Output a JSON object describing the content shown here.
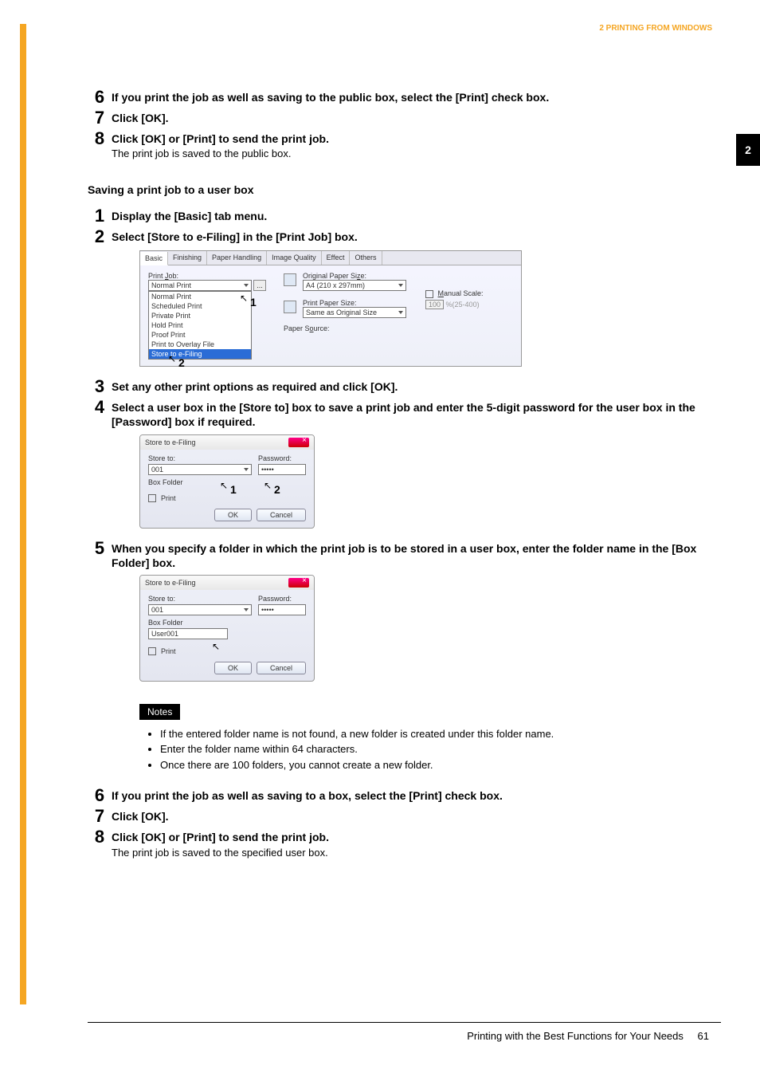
{
  "header": {
    "breadcrumb": "2 PRINTING FROM WINDOWS"
  },
  "chapter_tab": "2",
  "top_steps": [
    {
      "num": "6",
      "main": "If you print the job as well as saving to the public box, select the [Print] check box."
    },
    {
      "num": "7",
      "main": "Click [OK]."
    },
    {
      "num": "8",
      "main": "Click [OK] or [Print] to send the print job.",
      "sub": "The print job is saved to the public box."
    }
  ],
  "section_heading": "Saving a print job to a user box",
  "steps_a": [
    {
      "num": "1",
      "main": "Display the [Basic] tab menu."
    },
    {
      "num": "2",
      "main": "Select [Store to e-Filing] in the [Print Job] box."
    }
  ],
  "screenshot1": {
    "tabs": [
      "Basic",
      "Finishing",
      "Paper Handling",
      "Image Quality",
      "Effect",
      "Others"
    ],
    "printjob_label": "Print Job:",
    "printjob_value": "Normal Print",
    "job_options": [
      "Normal Print",
      "Scheduled Print",
      "Private Print",
      "Hold Print",
      "Proof Print",
      "Print to Overlay File",
      "Store to e-Filing"
    ],
    "original_label": "Original Paper Size:",
    "original_value": "A4 (210 x 297mm)",
    "printpaper_label": "Print Paper Size:",
    "printpaper_value": "Same as Original Size",
    "manual_scale_label": "Manual Scale:",
    "manual_scale_value": "100",
    "manual_scale_range": "%(25-400)",
    "paper_source_label": "Paper Source:",
    "cursor1_num": "1",
    "cursor2_num": "2"
  },
  "steps_b": [
    {
      "num": "3",
      "main": "Set any other print options as required and click [OK]."
    },
    {
      "num": "4",
      "main": "Select a user box in the [Store to] box to save a print job and enter the 5-digit password for the user box in the [Password] box if required."
    }
  ],
  "dialog1": {
    "title": "Store to e-Filing",
    "store_to_label": "Store to:",
    "store_to_value": "001",
    "password_label": "Password:",
    "password_value": "•••••",
    "box_folder_label": "Box Folder",
    "print_checkbox": "Print",
    "ok": "OK",
    "cancel": "Cancel",
    "cursor1_num": "1",
    "cursor2_num": "2"
  },
  "steps_c": [
    {
      "num": "5",
      "main": "When you specify a folder in which the print job is to be stored in a user box, enter the folder name in the [Box Folder] box."
    }
  ],
  "dialog2": {
    "title": "Store to e-Filing",
    "store_to_label": "Store to:",
    "store_to_value": "001",
    "password_label": "Password:",
    "password_value": "•••••",
    "box_folder_label": "Box Folder",
    "box_folder_value": "User001",
    "print_checkbox": "Print",
    "ok": "OK",
    "cancel": "Cancel"
  },
  "notes": {
    "badge": "Notes",
    "items": [
      "If the entered folder name is not found, a new folder is created under this folder name.",
      "Enter the folder name within 64 characters.",
      "Once there are 100 folders, you cannot create a new folder."
    ]
  },
  "bottom_steps": [
    {
      "num": "6",
      "main": "If you print the job as well as saving to a box, select the [Print] check box."
    },
    {
      "num": "7",
      "main": "Click [OK]."
    },
    {
      "num": "8",
      "main": "Click [OK] or [Print] to send the print job.",
      "sub": "The print job is saved to the specified user box."
    }
  ],
  "footer": {
    "text": "Printing with the Best Functions for Your Needs",
    "page": "61"
  }
}
